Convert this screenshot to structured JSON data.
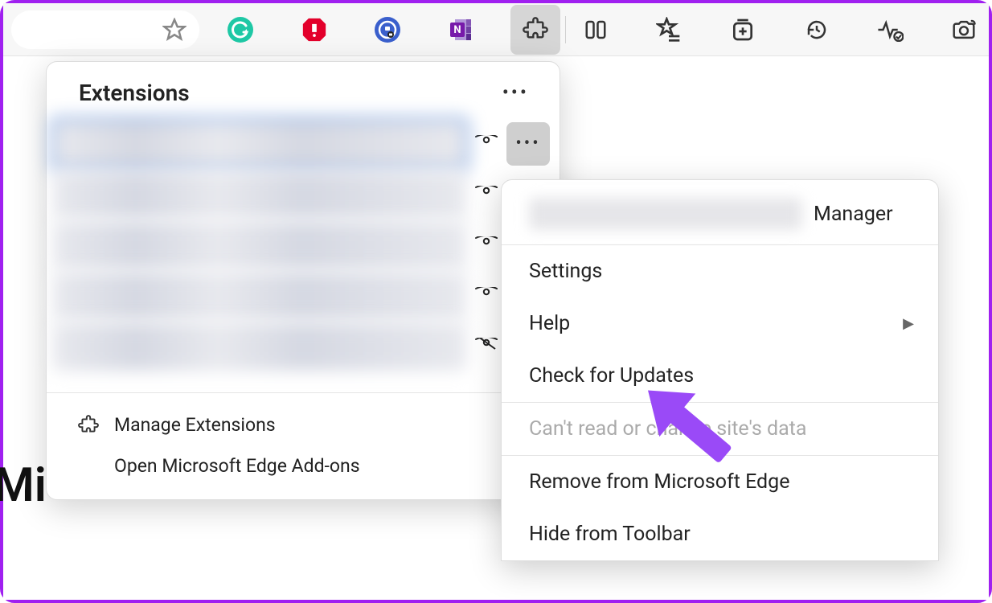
{
  "toolbar": {
    "icons": [
      "star",
      "grammarly",
      "adblock",
      "lastpass",
      "onenote",
      "extensions",
      "split",
      "favorites",
      "collections",
      "history",
      "performance",
      "screenshot"
    ]
  },
  "background_partial_text": "Mi",
  "ext_panel": {
    "title": "Extensions",
    "rows": [
      {
        "visible": true,
        "off": false,
        "selected": true,
        "more_active": true
      },
      {
        "visible": true,
        "off": false,
        "selected": false,
        "more_active": false
      },
      {
        "visible": true,
        "off": false,
        "selected": false,
        "more_active": false
      },
      {
        "visible": true,
        "off": false,
        "selected": false,
        "more_active": false
      },
      {
        "visible": true,
        "off": true,
        "selected": false,
        "more_active": false
      }
    ],
    "manage": "Manage Extensions",
    "addons": "Open Microsoft Edge Add-ons"
  },
  "ctx": {
    "header_suffix": "Manager",
    "items": [
      {
        "label": "Settings",
        "submenu": false,
        "disabled": false
      },
      {
        "label": "Help",
        "submenu": true,
        "disabled": false
      },
      {
        "label": "Check for Updates",
        "submenu": false,
        "disabled": false
      }
    ],
    "disabled_heading": "Can't read or change site's data",
    "items2": [
      {
        "label": "Remove from Microsoft Edge",
        "submenu": false
      },
      {
        "label": "Hide from Toolbar",
        "submenu": false
      }
    ]
  }
}
